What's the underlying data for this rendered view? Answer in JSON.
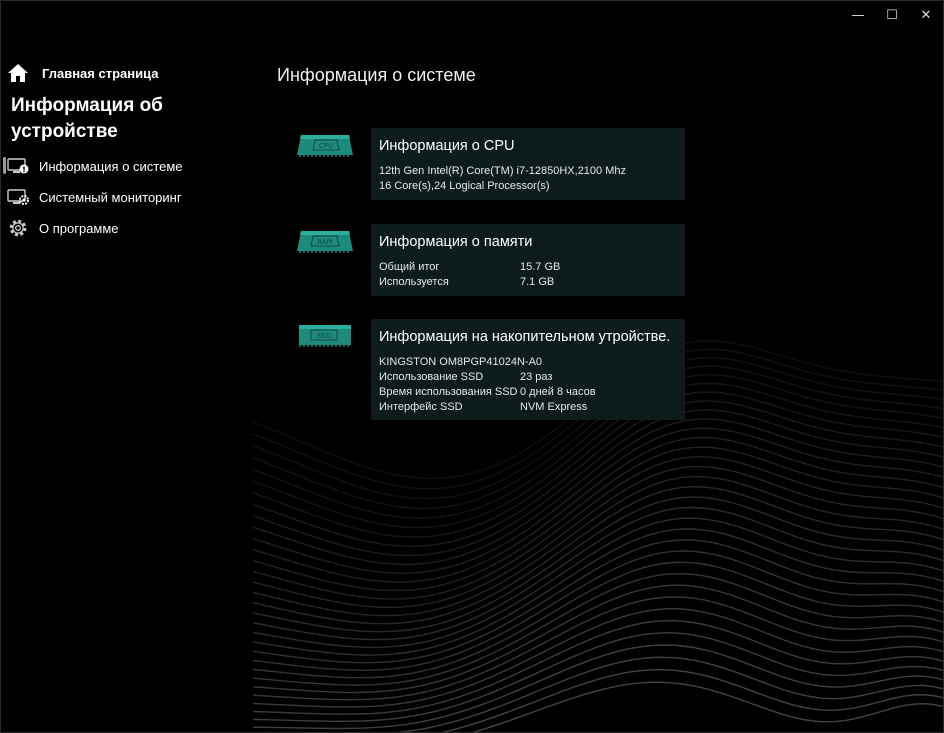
{
  "window_controls": {
    "minimize": "—",
    "maximize": "☐",
    "close": "✕"
  },
  "sidebar": {
    "home_label": "Главная страница",
    "section_title": "Информация об устройстве",
    "items": [
      {
        "label": "Информация о системе",
        "icon": "monitor-info-icon"
      },
      {
        "label": "Системный мониторинг",
        "icon": "monitor-gear-icon"
      },
      {
        "label": "О программе",
        "icon": "gear-icon"
      }
    ]
  },
  "main": {
    "title": "Информация о системе",
    "cards": {
      "cpu": {
        "chip_label": "CPU",
        "title": "Информация о CPU",
        "lines": [
          "12th Gen Intel(R) Core(TM) i7-12850HX,2100 Mhz",
          "16 Core(s),24 Logical Processor(s)"
        ]
      },
      "memory": {
        "chip_label": "RAM",
        "title": "Информация о памяти",
        "rows": [
          {
            "label": "Общий итог",
            "value": "15.7 GB"
          },
          {
            "label": "Используется",
            "value": "7.1 GB"
          }
        ]
      },
      "storage": {
        "chip_label": "SSD",
        "title": "Информация на накопительном утройстве.",
        "model": "KINGSTON OM8PGP41024N-A0",
        "rows": [
          {
            "label": "Использование SSD",
            "value": "23 раз"
          },
          {
            "label": "Время использования SSD",
            "value": "0 дней 8 часов"
          },
          {
            "label": "Интерфейс SSD",
            "value": "NVM Express"
          }
        ]
      }
    }
  },
  "colors": {
    "card_bg": "#0e1b1b",
    "chip": "#1f8a7c",
    "background": "#000000"
  }
}
